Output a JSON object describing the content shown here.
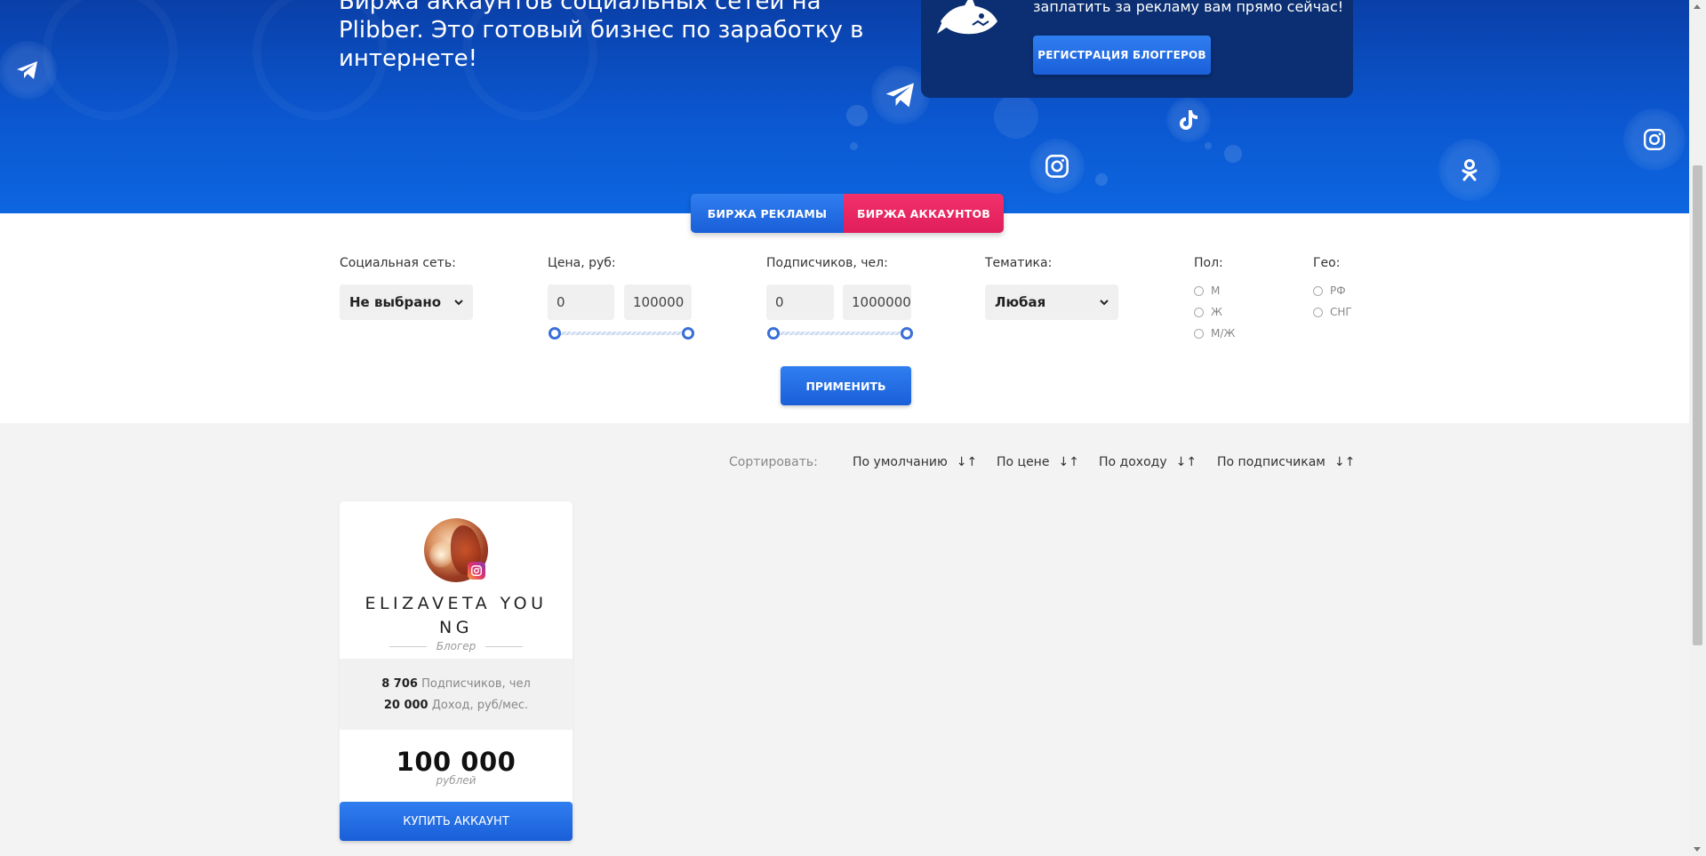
{
  "hero": {
    "text": "Биржа аккаунтов социальных сетей на Plibber. Это готовый бизнес по заработку в интернете!",
    "promo_text": "заплатить за рекламу вам прямо сейчас!",
    "promo_button": "РЕГИСТРАЦИЯ БЛОГГЕРОВ"
  },
  "tabs": [
    {
      "label": "БИРЖА РЕКЛАМЫ",
      "active": false
    },
    {
      "label": "БИРЖА АККАУНТОВ",
      "active": true
    }
  ],
  "filters": {
    "social": {
      "label": "Социальная сеть:",
      "value": "Не выбрано"
    },
    "price": {
      "label": "Цена, руб:",
      "min": "0",
      "max": "100000"
    },
    "subscribers": {
      "label": "Подписчиков, чел:",
      "min": "0",
      "max": "1000000"
    },
    "topic": {
      "label": "Тематика:",
      "value": "Любая"
    },
    "gender": {
      "label": "Пол:",
      "options": [
        "М",
        "Ж",
        "М/Ж"
      ]
    },
    "geo": {
      "label": "Гео:",
      "options": [
        "РФ",
        "СНГ"
      ]
    },
    "apply": "ПРИМЕНИТЬ"
  },
  "sort": {
    "label": "Сортировать:",
    "options": [
      "По умолчанию",
      "По цене",
      "По доходу",
      "По подписчикам"
    ],
    "arrows": "↓↑"
  },
  "cards": [
    {
      "name": "ELIZAVETA YOUNG",
      "role": "Блогер",
      "subscribers_value": "8 706",
      "subscribers_label": "Подписчиков, чел",
      "income_value": "20 000",
      "income_label": "Доход, руб/мес.",
      "price": "100 000",
      "currency": "рублей",
      "buy_label": "КУПИТЬ АККАУНТ",
      "network_icon": "instagram-icon"
    }
  ],
  "colors": {
    "primary_blue": "#1a5fd8",
    "accent_pink": "#e01e5c",
    "hero_dark": "#0b2f72"
  }
}
